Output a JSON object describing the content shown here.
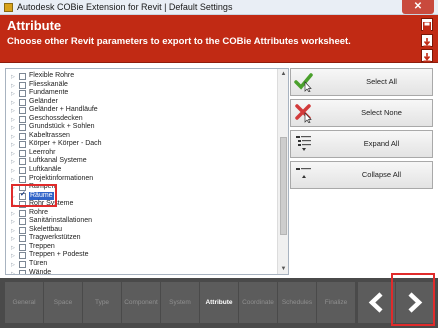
{
  "window": {
    "title": "Autodesk COBie Extension for Revit | Default Settings",
    "close_symbol": "✕"
  },
  "header": {
    "title": "Attribute",
    "subtitle": "Choose other Revit parameters to export to the COBie Attributes worksheet."
  },
  "tree": {
    "items": [
      {
        "label": "Flexible Rohre",
        "checked": false,
        "selected": false
      },
      {
        "label": "Fliesskanäle",
        "checked": false,
        "selected": false
      },
      {
        "label": "Fundamente",
        "checked": false,
        "selected": false
      },
      {
        "label": "Geländer",
        "checked": false,
        "selected": false
      },
      {
        "label": "Geländer + Handläufe",
        "checked": false,
        "selected": false
      },
      {
        "label": "Geschossdecken",
        "checked": false,
        "selected": false
      },
      {
        "label": "Grundstück + Sohlen",
        "checked": false,
        "selected": false
      },
      {
        "label": "Kabeltrassen",
        "checked": false,
        "selected": false
      },
      {
        "label": "Körper + Körper - Dach",
        "checked": false,
        "selected": false
      },
      {
        "label": "Leerrohr",
        "checked": false,
        "selected": false
      },
      {
        "label": "Luftkanal Systeme",
        "checked": false,
        "selected": false
      },
      {
        "label": "Luftkanäle",
        "checked": false,
        "selected": false
      },
      {
        "label": "Projektinformationen",
        "checked": false,
        "selected": false
      },
      {
        "label": "Rampen",
        "checked": false,
        "selected": false
      },
      {
        "label": "Räume",
        "checked": true,
        "selected": true
      },
      {
        "label": "Rohr Systeme",
        "checked": false,
        "selected": false
      },
      {
        "label": "Rohre",
        "checked": false,
        "selected": false
      },
      {
        "label": "Sanitärinstallationen",
        "checked": false,
        "selected": false
      },
      {
        "label": "Skelettbau",
        "checked": false,
        "selected": false
      },
      {
        "label": "Tragwerkstützen",
        "checked": false,
        "selected": false
      },
      {
        "label": "Treppen",
        "checked": false,
        "selected": false
      },
      {
        "label": "Treppen + Podeste",
        "checked": false,
        "selected": false
      },
      {
        "label": "Türen",
        "checked": false,
        "selected": false
      },
      {
        "label": "Wände",
        "checked": false,
        "selected": false
      }
    ]
  },
  "actions": {
    "select_all": "Select All",
    "select_none": "Select None",
    "expand_all": "Expand All",
    "collapse_all": "Collapse All"
  },
  "nav": {
    "tabs": [
      {
        "label": "General",
        "active": false
      },
      {
        "label": "Space",
        "active": false
      },
      {
        "label": "Type",
        "active": false
      },
      {
        "label": "Component",
        "active": false
      },
      {
        "label": "System",
        "active": false
      },
      {
        "label": "Attribute",
        "active": true
      },
      {
        "label": "Coordinate",
        "active": false
      },
      {
        "label": "Schedules",
        "active": false
      },
      {
        "label": "Finalize",
        "active": false
      }
    ]
  },
  "icons": {
    "app": "autodesk-app-icon",
    "close": "close-icon",
    "save": "save-icon",
    "export_down_1": "download-icon",
    "export_down_2": "download-icon",
    "select_all": "green-check-icon",
    "select_none": "red-x-icon",
    "expand_all": "expand-list-icon",
    "collapse_all": "collapse-list-icon",
    "back": "chevron-left-icon",
    "next": "chevron-right-icon"
  },
  "colors": {
    "header_bg": "#c12a14",
    "nav_bg": "#4a4a4a",
    "selection": "#2f63c8",
    "highlight_annotation": "#e02b2b",
    "check_green": "#4aa02c",
    "x_red": "#d23a3a"
  }
}
